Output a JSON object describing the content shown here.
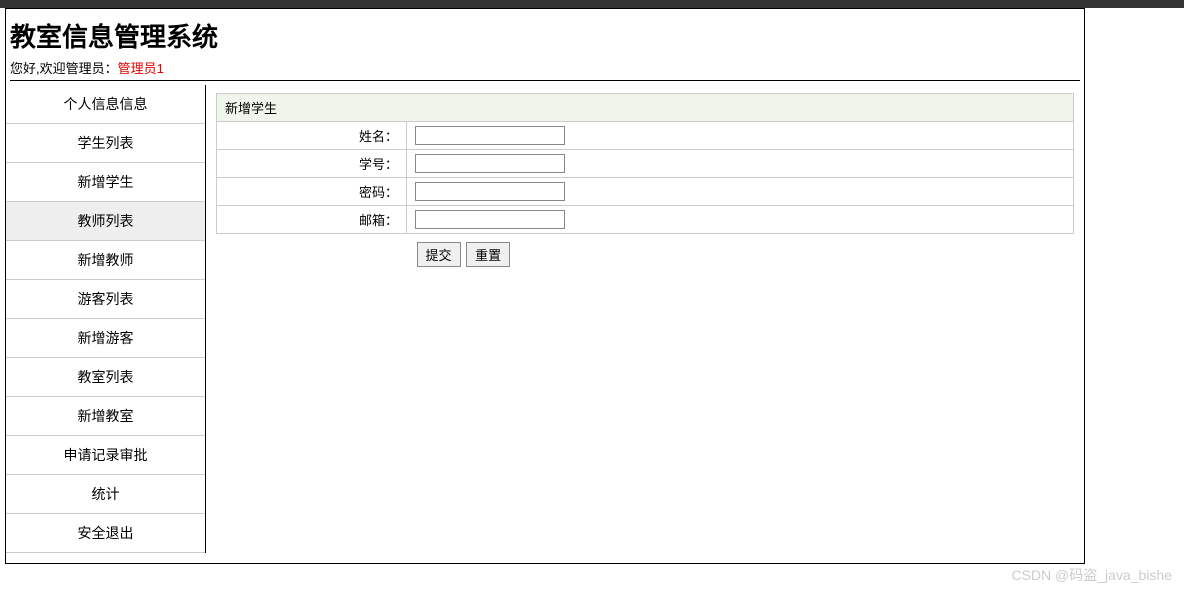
{
  "header": {
    "title": "教室信息管理系统",
    "welcome_prefix": "您好,欢迎管理员：",
    "admin_name": "管理员1"
  },
  "sidebar": {
    "items": [
      {
        "label": "个人信息信息"
      },
      {
        "label": "学生列表"
      },
      {
        "label": "新增学生"
      },
      {
        "label": "教师列表"
      },
      {
        "label": "新增教师"
      },
      {
        "label": "游客列表"
      },
      {
        "label": "新增游客"
      },
      {
        "label": "教室列表"
      },
      {
        "label": "新增教室"
      },
      {
        "label": "申请记录审批"
      },
      {
        "label": "统计"
      },
      {
        "label": "安全退出"
      }
    ],
    "active_index": 3
  },
  "form": {
    "title": "新增学生",
    "fields": {
      "name_label": "姓名：",
      "name_value": "",
      "student_id_label": "学号：",
      "student_id_value": "",
      "password_label": "密码：",
      "password_value": "",
      "email_label": "邮箱：",
      "email_value": ""
    },
    "buttons": {
      "submit": "提交",
      "reset": "重置"
    }
  },
  "watermark": "CSDN @码盗_java_bishe"
}
